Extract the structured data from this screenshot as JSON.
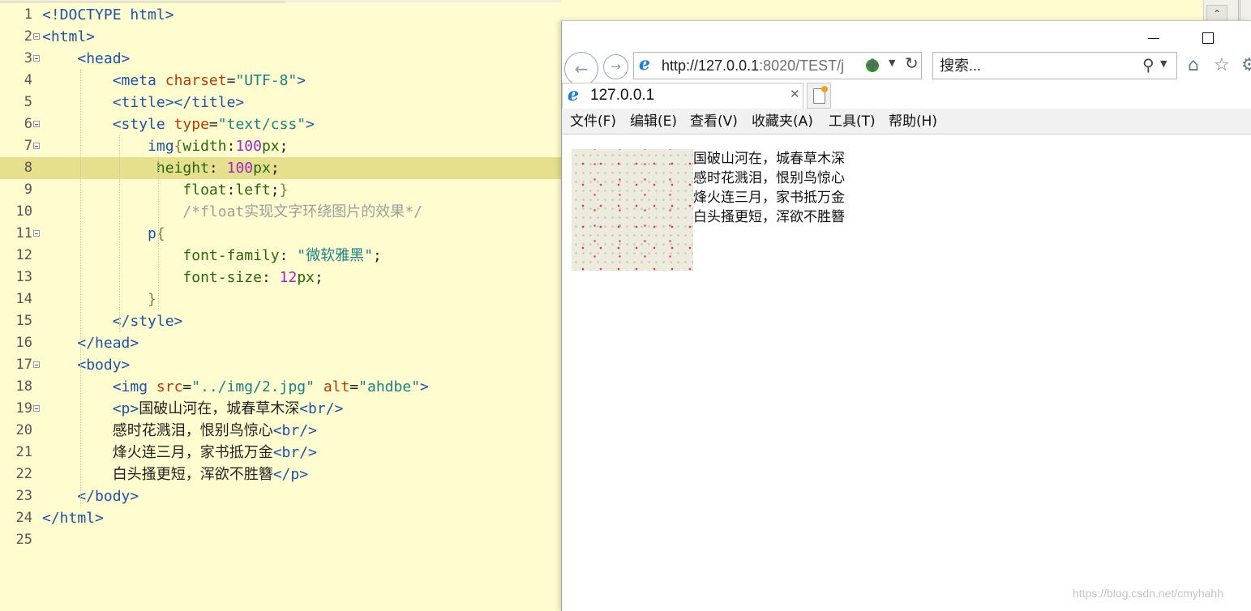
{
  "editor": {
    "lines": [
      {
        "n": "1",
        "fold": false,
        "toks": [
          [
            "tag",
            "<!DOCTYPE html>"
          ]
        ]
      },
      {
        "n": "2",
        "fold": true,
        "toks": [
          [
            "tag",
            "<html>"
          ]
        ]
      },
      {
        "n": "3",
        "fold": true,
        "toks": [
          [
            "plain",
            "    "
          ],
          [
            "tag",
            "<head>"
          ]
        ]
      },
      {
        "n": "4",
        "fold": false,
        "toks": [
          [
            "plain",
            "        "
          ],
          [
            "tag",
            "<meta "
          ],
          [
            "attr",
            "charset"
          ],
          [
            "plain",
            "="
          ],
          [
            "str",
            "\"UTF-8\""
          ],
          [
            "tag",
            ">"
          ]
        ]
      },
      {
        "n": "5",
        "fold": false,
        "toks": [
          [
            "plain",
            "        "
          ],
          [
            "tag",
            "<title></title>"
          ]
        ]
      },
      {
        "n": "6",
        "fold": true,
        "toks": [
          [
            "plain",
            "        "
          ],
          [
            "tag",
            "<style "
          ],
          [
            "attr",
            "type"
          ],
          [
            "plain",
            "="
          ],
          [
            "str",
            "\"text/css\""
          ],
          [
            "tag",
            ">"
          ]
        ]
      },
      {
        "n": "7",
        "fold": true,
        "toks": [
          [
            "plain",
            "            "
          ],
          [
            "tag",
            "img"
          ],
          [
            "brace",
            "{"
          ],
          [
            "css",
            "width"
          ],
          [
            "plain",
            ":"
          ],
          [
            "num",
            "100"
          ],
          [
            "css",
            "px"
          ],
          [
            "plain",
            ";"
          ]
        ]
      },
      {
        "n": "8",
        "fold": false,
        "hl": true,
        "toks": [
          [
            "plain",
            "             "
          ],
          [
            "css",
            "height"
          ],
          [
            "plain",
            ": "
          ],
          [
            "num",
            "100"
          ],
          [
            "css",
            "px"
          ],
          [
            "plain",
            ";"
          ]
        ]
      },
      {
        "n": "9",
        "fold": false,
        "toks": [
          [
            "plain",
            "                "
          ],
          [
            "css",
            "float"
          ],
          [
            "plain",
            ":"
          ],
          [
            "css",
            "left"
          ],
          [
            "plain",
            ";"
          ],
          [
            "brace",
            "}"
          ]
        ]
      },
      {
        "n": "10",
        "fold": false,
        "toks": [
          [
            "plain",
            "                "
          ],
          [
            "com",
            "/*float实现文字环绕图片的效果*/"
          ]
        ]
      },
      {
        "n": "11",
        "fold": true,
        "toks": [
          [
            "plain",
            "            "
          ],
          [
            "tag",
            "p"
          ],
          [
            "brace",
            "{"
          ]
        ]
      },
      {
        "n": "12",
        "fold": false,
        "toks": [
          [
            "plain",
            "                "
          ],
          [
            "css",
            "font-family"
          ],
          [
            "plain",
            ": "
          ],
          [
            "str",
            "\"微软雅黑\""
          ],
          [
            "plain",
            ";"
          ]
        ]
      },
      {
        "n": "13",
        "fold": false,
        "toks": [
          [
            "plain",
            "                "
          ],
          [
            "css",
            "font-size"
          ],
          [
            "plain",
            ": "
          ],
          [
            "num",
            "12"
          ],
          [
            "css",
            "px"
          ],
          [
            "plain",
            ";"
          ]
        ]
      },
      {
        "n": "14",
        "fold": false,
        "toks": [
          [
            "plain",
            "            "
          ],
          [
            "brace",
            "}"
          ]
        ]
      },
      {
        "n": "15",
        "fold": false,
        "toks": [
          [
            "plain",
            "        "
          ],
          [
            "tag",
            "</style>"
          ]
        ]
      },
      {
        "n": "16",
        "fold": false,
        "toks": [
          [
            "plain",
            "    "
          ],
          [
            "tag",
            "</head>"
          ]
        ]
      },
      {
        "n": "17",
        "fold": true,
        "toks": [
          [
            "plain",
            "    "
          ],
          [
            "tag",
            "<body>"
          ]
        ]
      },
      {
        "n": "18",
        "fold": false,
        "toks": [
          [
            "plain",
            "        "
          ],
          [
            "tag",
            "<img "
          ],
          [
            "attr",
            "src"
          ],
          [
            "plain",
            "="
          ],
          [
            "str",
            "\"../img/2.jpg\""
          ],
          [
            "plain",
            " "
          ],
          [
            "attr",
            "alt"
          ],
          [
            "plain",
            "="
          ],
          [
            "str",
            "\"ahdbe\""
          ],
          [
            "tag",
            ">"
          ]
        ]
      },
      {
        "n": "19",
        "fold": true,
        "toks": [
          [
            "plain",
            "        "
          ],
          [
            "tag",
            "<p>"
          ],
          [
            "plain",
            "国破山河在，城春草木深"
          ],
          [
            "tag",
            "<br/>"
          ]
        ]
      },
      {
        "n": "20",
        "fold": false,
        "toks": [
          [
            "plain",
            "        感时花溅泪，恨别鸟惊心"
          ],
          [
            "tag",
            "<br/>"
          ]
        ]
      },
      {
        "n": "21",
        "fold": false,
        "toks": [
          [
            "plain",
            "        烽火连三月，家书抵万金"
          ],
          [
            "tag",
            "<br/>"
          ]
        ]
      },
      {
        "n": "22",
        "fold": false,
        "toks": [
          [
            "plain",
            "        白头搔更短，浑欲不胜簪"
          ],
          [
            "tag",
            "</p>"
          ]
        ]
      },
      {
        "n": "23",
        "fold": false,
        "toks": [
          [
            "plain",
            "    "
          ],
          [
            "tag",
            "</body>"
          ]
        ]
      },
      {
        "n": "24",
        "fold": false,
        "toks": [
          [
            "tag",
            "</html>"
          ]
        ]
      },
      {
        "n": "25",
        "fold": false,
        "toks": []
      }
    ]
  },
  "browser": {
    "address_host": "http://127.0.0.1",
    "address_rest": ":8020/TEST/j",
    "search_placeholder": "搜索...",
    "tab_title": "127.0.0.1",
    "menu": [
      {
        "label": "文件(F)",
        "name": "menu-file"
      },
      {
        "label": "编辑(E)",
        "name": "menu-edit"
      },
      {
        "label": "查看(V)",
        "name": "menu-view"
      },
      {
        "label": "收藏夹(A)",
        "name": "menu-favorites"
      },
      {
        "label": "工具(T)",
        "name": "menu-tools"
      },
      {
        "label": "帮助(H)",
        "name": "menu-help"
      }
    ],
    "poem": [
      "国破山河在，城春草木深",
      "感时花溅泪，恨别鸟惊心",
      "烽火连三月，家书抵万金",
      "白头搔更短，浑欲不胜簪"
    ]
  },
  "icons": {
    "back": "back-arrow-icon",
    "forward": "forward-arrow-icon",
    "ie": "ie-logo-icon",
    "compat": "compatibility-view-icon",
    "refresh": "refresh-icon",
    "search": "search-icon",
    "home": "home-icon",
    "favorites": "star-icon",
    "settings": "gear-icon",
    "close": "close-icon",
    "new_tab": "new-tab-icon"
  },
  "colors": {
    "editor_bg": "#fffdd0",
    "current_line": "#e6e08e",
    "tag": "#1d52a8",
    "attribute": "#b53b00",
    "string": "#1b7f86",
    "css_property": "#27660f",
    "number": "#9b2ac8",
    "comment": "#9aa0a0"
  },
  "watermark": "https://blog.csdn.net/cmyhahh"
}
